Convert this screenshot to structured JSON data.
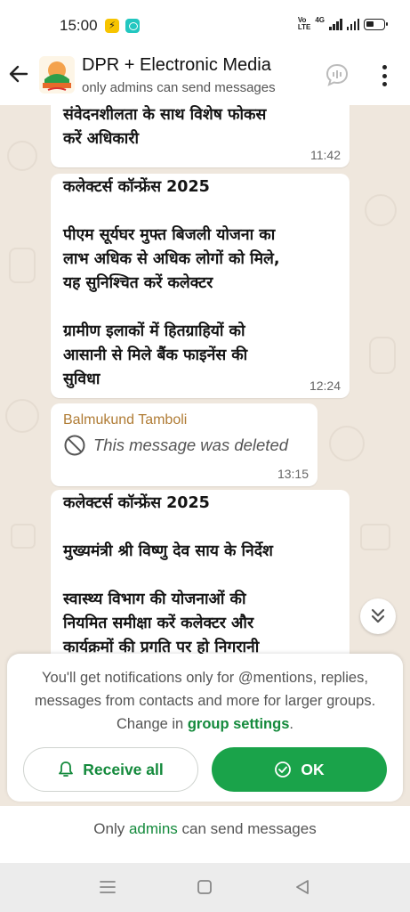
{
  "status_bar": {
    "time": "15:00",
    "network_label_top": "Vo",
    "network_label_bottom": "LTE",
    "network_type": "4G",
    "icons": [
      "lightning-app-icon",
      "chat-app-icon",
      "signal-icon",
      "battery-icon"
    ]
  },
  "header": {
    "title": "DPR + Electronic Media",
    "subtitle": "only admins can send messages",
    "icons": [
      "back-arrow-icon",
      "group-avatar",
      "voice-chat-icon",
      "more-options-icon"
    ]
  },
  "messages": [
    {
      "text": "संवेदनशीलता के साथ विशेष फोकस\nकरें अधिकारी",
      "time": "11:42"
    },
    {
      "text": "कलेक्टर्स कॉन्फ्रेंस 2025\n\nपीएम सूर्यघर मुफ्त बिजली योजना का\nलाभ अधिक से अधिक लोगों को मिले,\nयह सुनिश्चित करें कलेक्टर\n\nग्रामीण इलाकों में हितग्राहियों को\nआसानी से मिले बैंक फाइनेंस की\nसुविधा",
      "time": "12:24"
    },
    {
      "sender": "Balmukund Tamboli",
      "deleted_text": "This message was deleted",
      "time": "13:15"
    },
    {
      "text": "कलेक्टर्स कॉन्फ्रेंस 2025\n\nमुख्यमंत्री श्री विष्णु देव साय के निर्देश\n\nस्वास्थ्य विभाग की योजनाओं की\nनियमित समीक्षा करें कलेक्टर और\nकार्यक्रमों की प्रगति पर हो निगरानी"
    }
  ],
  "notice": {
    "text_before": "You'll get notifications only for @mentions, replies, messages from contacts and more for larger groups. Change in ",
    "link": "group settings",
    "text_after": ".",
    "receive_all_label": "Receive all",
    "ok_label": "OK"
  },
  "footer": {
    "text_before": "Only ",
    "link": "admins",
    "text_after": " can send messages"
  },
  "colors": {
    "accent_green": "#1aa34a",
    "link_green": "#148a3c",
    "sender_color": "#b07c35",
    "chat_background": "#efe7dd"
  }
}
